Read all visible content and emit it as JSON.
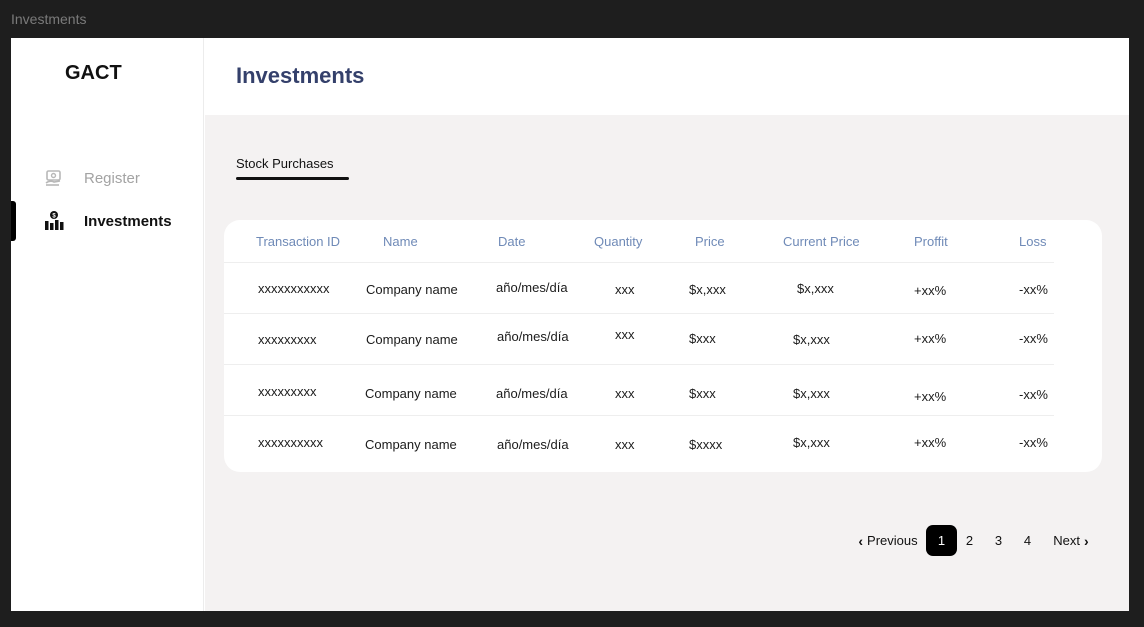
{
  "window": {
    "title": "Investments"
  },
  "sidebar": {
    "brand": "GACT",
    "items": [
      {
        "label": "Register",
        "icon": "register-icon",
        "active": false
      },
      {
        "label": "Investments",
        "icon": "investments-icon",
        "active": true
      }
    ]
  },
  "header": {
    "title": "Investments"
  },
  "tabs": [
    {
      "label": "Stock Purchases",
      "active": true
    }
  ],
  "table": {
    "columns": [
      "Transaction ID",
      "Name",
      "Date",
      "Quantity",
      "Price",
      "Current Price",
      "Proffit",
      "Loss"
    ],
    "rows": [
      [
        "xxxxxxxxxxx",
        "Company name",
        "año/mes/día",
        "xxx",
        "$x,xxx",
        "$x,xxx",
        "+xx%",
        "-xx%"
      ],
      [
        "xxxxxxxxx",
        "Company name",
        "año/mes/día",
        "xxx",
        "$xxx",
        "$x,xxx",
        "+xx%",
        "-xx%"
      ],
      [
        "xxxxxxxxx",
        "Company name",
        "año/mes/día",
        "xxx",
        "$xxx",
        "$x,xxx",
        "+xx%",
        "-xx%"
      ],
      [
        "xxxxxxxxxx",
        "Company name",
        "año/mes/día",
        "xxx",
        "$xxxx",
        "$x,xxx",
        "+xx%",
        "-xx%"
      ]
    ]
  },
  "pagination": {
    "previous": "Previous",
    "next": "Next",
    "pages": [
      "1",
      "2",
      "3",
      "4"
    ],
    "current": "1"
  },
  "colors": {
    "title": "#34406b",
    "header_text": "#6f8ab7",
    "content_bg": "#f4f2f2",
    "active": "#000000"
  }
}
